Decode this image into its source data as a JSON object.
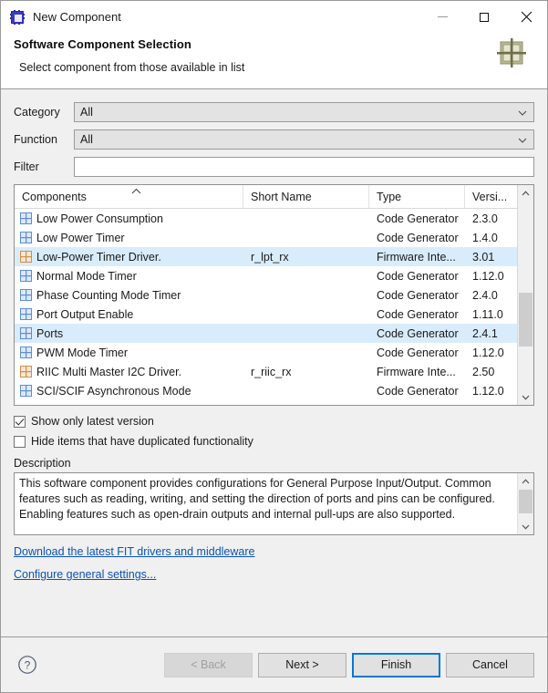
{
  "window": {
    "title": "New Component",
    "icon": "chip-icon",
    "minimize_label": "—",
    "maximize_label": "□",
    "close_label": "✕"
  },
  "header": {
    "title": "Software Component Selection",
    "subtitle": "Select component from those available in list",
    "icon": "component-grid-icon"
  },
  "form": {
    "category": {
      "label": "Category",
      "value": "All"
    },
    "function": {
      "label": "Function",
      "value": "All"
    },
    "filter": {
      "label": "Filter",
      "value": "",
      "placeholder": ""
    }
  },
  "table": {
    "columns": [
      {
        "key": "components",
        "label": "Components",
        "sorted": "ascending"
      },
      {
        "key": "short_name",
        "label": "Short Name",
        "sorted": ""
      },
      {
        "key": "type",
        "label": "Type",
        "sorted": ""
      },
      {
        "key": "version",
        "label": "Versi...",
        "sorted": ""
      }
    ],
    "rows": [
      {
        "name": "Low Power Consumption",
        "short_name": "",
        "type": "Code Generator",
        "version": "2.3.0",
        "icon": "grid-icon-blue",
        "selected": false
      },
      {
        "name": "Low Power Timer",
        "short_name": "",
        "type": "Code Generator",
        "version": "1.4.0",
        "icon": "grid-icon-blue",
        "selected": false
      },
      {
        "name": "Low-Power Timer Driver.",
        "short_name": "r_lpt_rx",
        "type": "Firmware Inte...",
        "version": "3.01",
        "icon": "grid-icon-orange",
        "selected": true
      },
      {
        "name": "Normal Mode Timer",
        "short_name": "",
        "type": "Code Generator",
        "version": "1.12.0",
        "icon": "grid-icon-blue",
        "selected": false
      },
      {
        "name": "Phase Counting Mode Timer",
        "short_name": "",
        "type": "Code Generator",
        "version": "2.4.0",
        "icon": "grid-icon-blue",
        "selected": false
      },
      {
        "name": "Port Output Enable",
        "short_name": "",
        "type": "Code Generator",
        "version": "1.11.0",
        "icon": "grid-icon-blue",
        "selected": false
      },
      {
        "name": "Ports",
        "short_name": "",
        "type": "Code Generator",
        "version": "2.4.1",
        "icon": "grid-icon-blue",
        "selected": true
      },
      {
        "name": "PWM Mode Timer",
        "short_name": "",
        "type": "Code Generator",
        "version": "1.12.0",
        "icon": "grid-icon-blue",
        "selected": false
      },
      {
        "name": "RIIC Multi Master I2C Driver.",
        "short_name": "r_riic_rx",
        "type": "Firmware Inte...",
        "version": "2.50",
        "icon": "grid-icon-orange",
        "selected": false
      },
      {
        "name": "SCI/SCIF Asynchronous Mode",
        "short_name": "",
        "type": "Code Generator",
        "version": "1.12.0",
        "icon": "grid-icon-blue",
        "selected": false
      }
    ]
  },
  "options": {
    "show_latest": {
      "label": "Show only latest version",
      "checked": true
    },
    "hide_duplicated": {
      "label": "Hide items that have duplicated functionality",
      "checked": false
    }
  },
  "description": {
    "label": "Description",
    "text": "This software component provides configurations for General Purpose Input/Output. Common features such as reading, writing, and setting the direction of ports and pins can be configured. Enabling features such as open-drain outputs and internal pull-ups are also supported."
  },
  "links": {
    "download": "Download the latest FIT drivers and middleware",
    "configure": "Configure general settings..."
  },
  "footer": {
    "help_icon": "question-mark-icon",
    "back": "< Back",
    "next": "Next >",
    "finish": "Finish",
    "cancel": "Cancel"
  },
  "colors": {
    "accent": "#0078d7",
    "selection": "#d9ecfb",
    "link": "#0b53b5",
    "panel": "#f0f0f0",
    "icon_blue": "#5b8fd0",
    "icon_orange": "#d08f4a",
    "header_icon": "#a7a880"
  }
}
